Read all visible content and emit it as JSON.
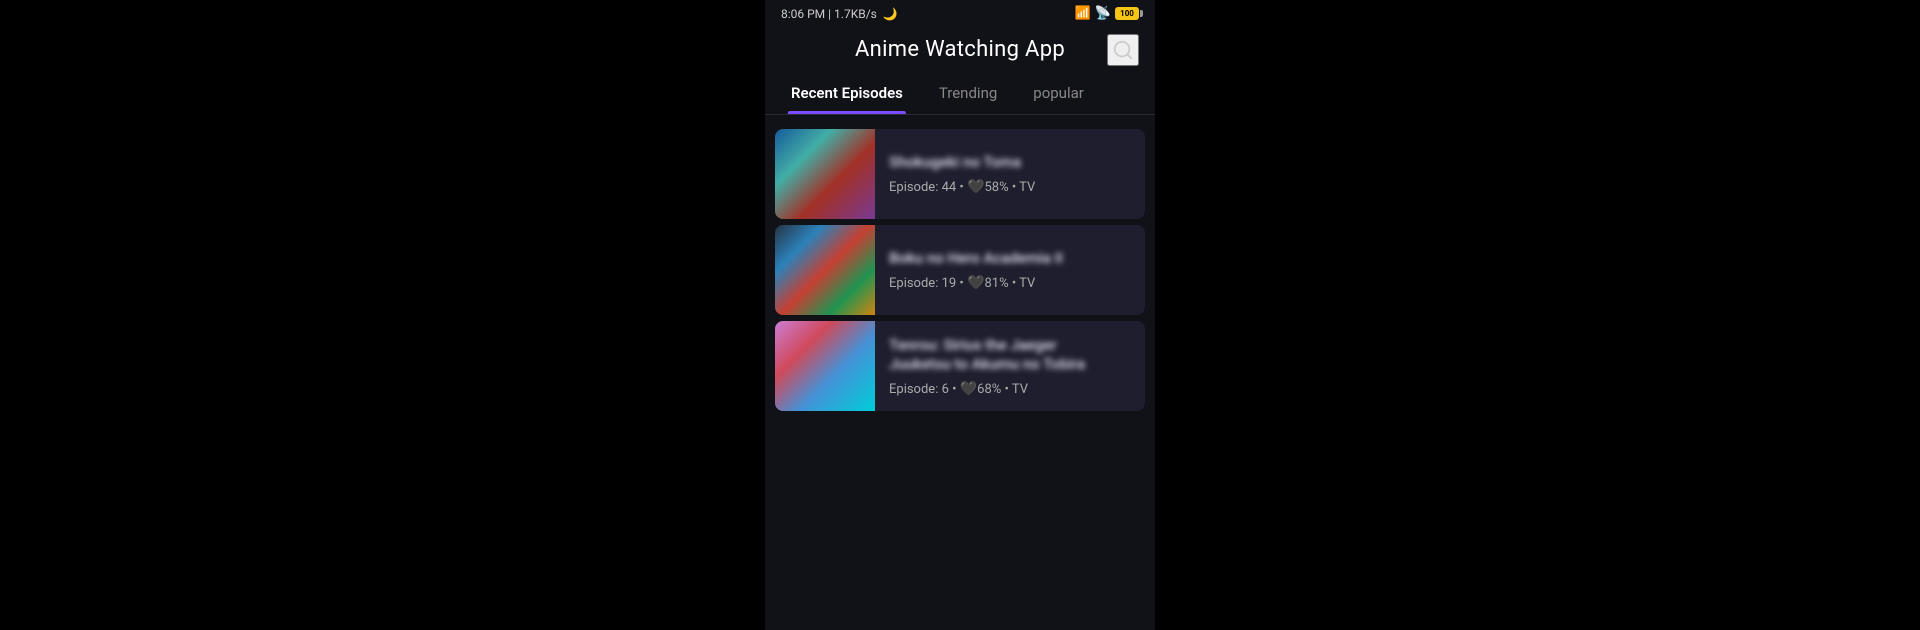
{
  "statusBar": {
    "time": "8:06 PM | 1.7KB/s",
    "moonIcon": "🌙",
    "battery": "battery-icon"
  },
  "header": {
    "title": "Anime Watching App",
    "searchLabel": "search"
  },
  "tabs": [
    {
      "id": "recent",
      "label": "Recent Episodes",
      "active": true
    },
    {
      "id": "trending",
      "label": "Trending",
      "active": false
    },
    {
      "id": "popular",
      "label": "popular",
      "active": false
    }
  ],
  "episodes": [
    {
      "id": 1,
      "title": "Shokugeki no Toma",
      "titleBlurred": "Shokugeki no Toma",
      "episodeNum": "44",
      "rating": "58%",
      "type": "TV",
      "metaText": "Episode: 44 • 💙58% • TV",
      "thumbClass": "thumb-1"
    },
    {
      "id": 2,
      "title": "Boku no Hero Academia II",
      "titleBlurred": "Boku no Hero Academia II",
      "episodeNum": "19",
      "rating": "81%",
      "type": "TV",
      "metaText": "Episode: 19 • 💙81% • TV",
      "thumbClass": "thumb-2"
    },
    {
      "id": 3,
      "title": "Tenrou: Sirius the Jaeger",
      "subtitle": "Juuketsu to Akumu no Tobira",
      "titleBlurred": "Tenrou: Sirius the Jaeger\nJuuketsu to Akumu no Tobira",
      "episodeNum": "6",
      "rating": "68%",
      "type": "TV",
      "metaText": "Episode: 6 • 💙68% • TV",
      "thumbClass": "thumb-3"
    }
  ],
  "icons": {
    "search": "🔍",
    "heart": "🖤"
  }
}
